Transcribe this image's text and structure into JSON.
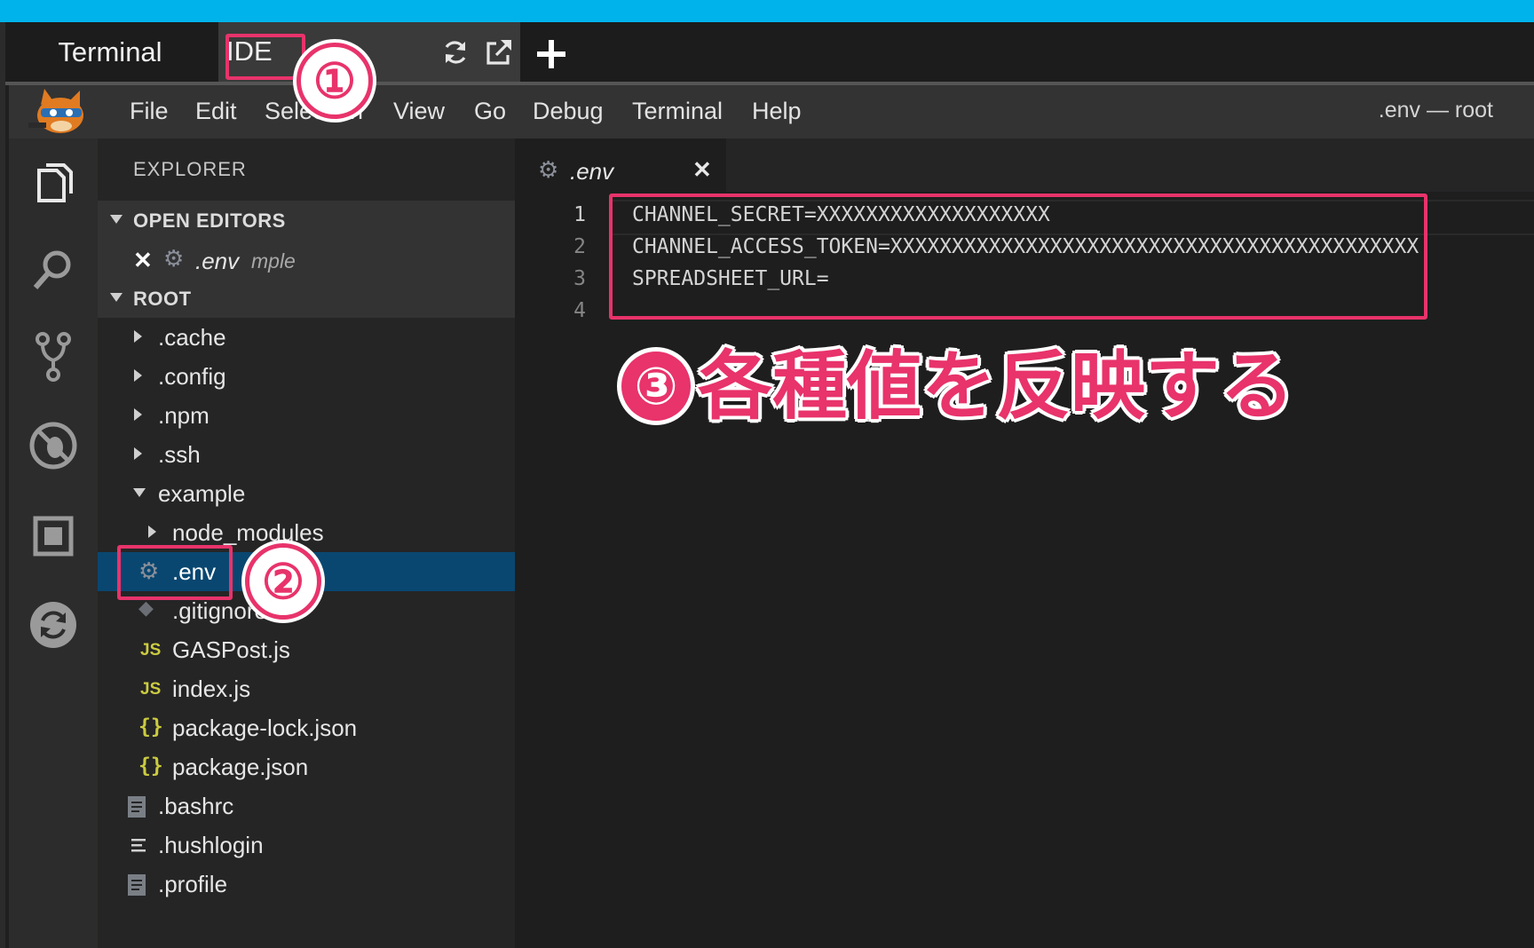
{
  "outer_tabs": {
    "terminal": "Terminal",
    "ide": "IDE"
  },
  "menu": [
    "File",
    "Edit",
    "Selection",
    "View",
    "Go",
    "Debug",
    "Terminal",
    "Help"
  ],
  "window_title": ".env — root",
  "explorer": {
    "title": "EXPLORER",
    "open_editors_label": "OPEN EDITORS",
    "open_editor_item": {
      "name": ".env",
      "path": "mple"
    },
    "root_label": "ROOT",
    "tree": [
      ".cache",
      ".config",
      ".npm",
      ".ssh",
      "example",
      "node_modules",
      ".env",
      ".gitignore",
      "GASPost.js",
      "index.js",
      "package-lock.json",
      "package.json",
      ".bashrc",
      ".hushlogin",
      ".profile"
    ]
  },
  "editor": {
    "tab_name": ".env",
    "line_numbers": [
      "1",
      "2",
      "3",
      "4"
    ],
    "lines": [
      "CHANNEL_SECRET=XXXXXXXXXXXXXXXXXXX",
      "CHANNEL_ACCESS_TOKEN=XXXXXXXXXXXXXXXXXXXXXXXXXXXXXXXXXXXXXXXXXXX",
      "SPREADSHEET_URL=",
      ""
    ]
  },
  "annotations": {
    "step1": "①",
    "step2": "②",
    "step3_number": "③",
    "step3_text": "各種値を反映する"
  },
  "colors": {
    "accent": "#e8336b",
    "selection": "#094771",
    "topbar": "#00b3ea"
  }
}
